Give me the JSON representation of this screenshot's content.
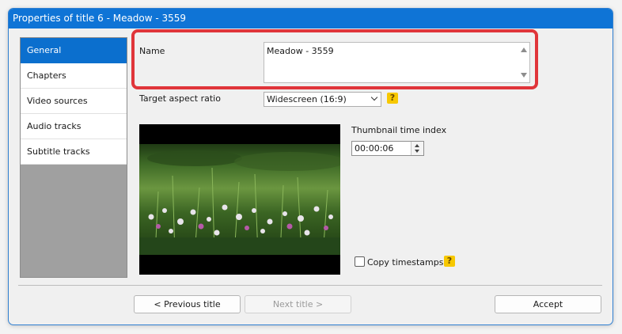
{
  "window": {
    "title": "Properties of title 6 - Meadow - 3559"
  },
  "sidebar": {
    "items": [
      {
        "label": "General",
        "active": true
      },
      {
        "label": "Chapters"
      },
      {
        "label": "Video sources"
      },
      {
        "label": "Audio tracks"
      },
      {
        "label": "Subtitle tracks"
      }
    ]
  },
  "general": {
    "name_label": "Name",
    "name_value": "Meadow - 3559",
    "aspect_label": "Target aspect ratio",
    "aspect_value": "Widescreen (16:9)",
    "help_glyph": "?",
    "thumbnail_label": "Thumbnail time index",
    "thumbnail_value": "00:00:06",
    "copy_timestamps_label": "Copy timestamps",
    "copy_timestamps_checked": false
  },
  "footer": {
    "prev_label": "< Previous title",
    "next_label": "Next title >",
    "accept_label": "Accept"
  },
  "colors": {
    "accent": "#0f74d6",
    "highlight": "#e0353a",
    "help_badge": "#f7c800"
  }
}
